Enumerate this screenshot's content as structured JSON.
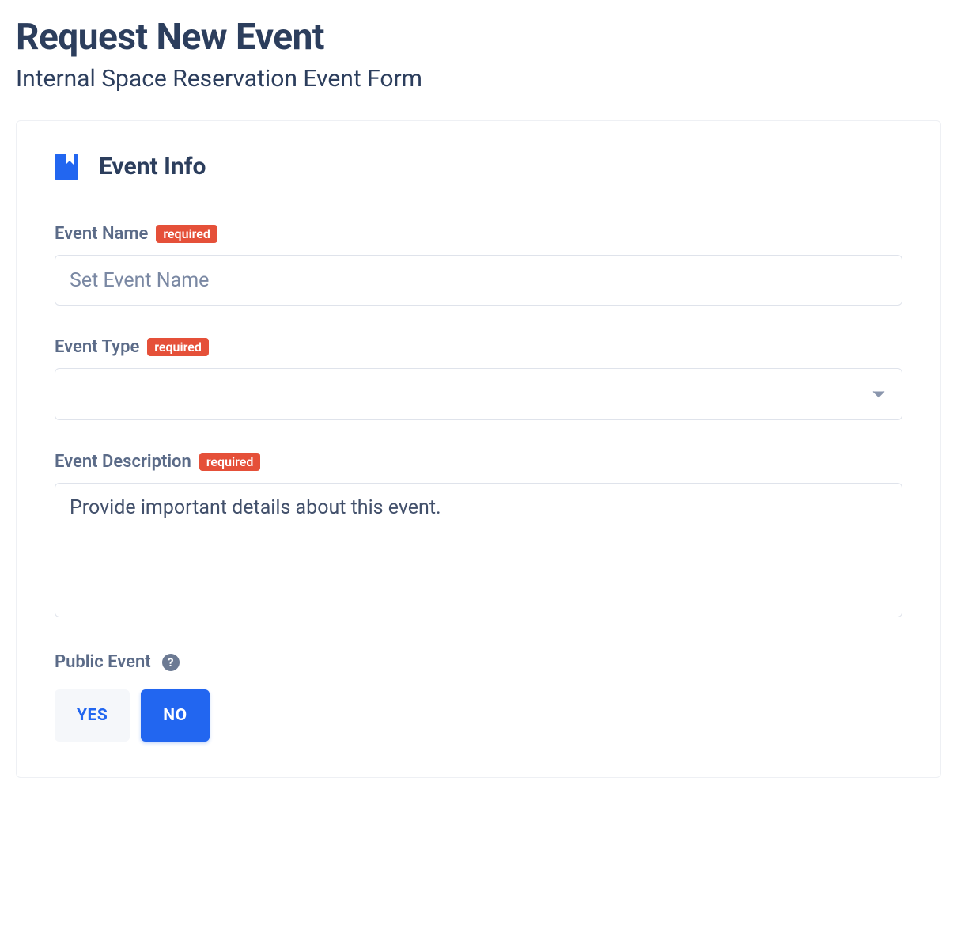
{
  "header": {
    "title": "Request New Event",
    "subtitle": "Internal Space Reservation Event Form"
  },
  "section": {
    "title": "Event Info"
  },
  "fields": {
    "event_name": {
      "label": "Event Name",
      "required_text": "required",
      "placeholder": "Set Event Name",
      "value": ""
    },
    "event_type": {
      "label": "Event Type",
      "required_text": "required",
      "value": ""
    },
    "event_description": {
      "label": "Event Description",
      "required_text": "required",
      "placeholder": "Provide important details about this event.",
      "value": ""
    },
    "public_event": {
      "label": "Public Event",
      "yes_label": "YES",
      "no_label": "NO",
      "selected": "NO"
    }
  }
}
